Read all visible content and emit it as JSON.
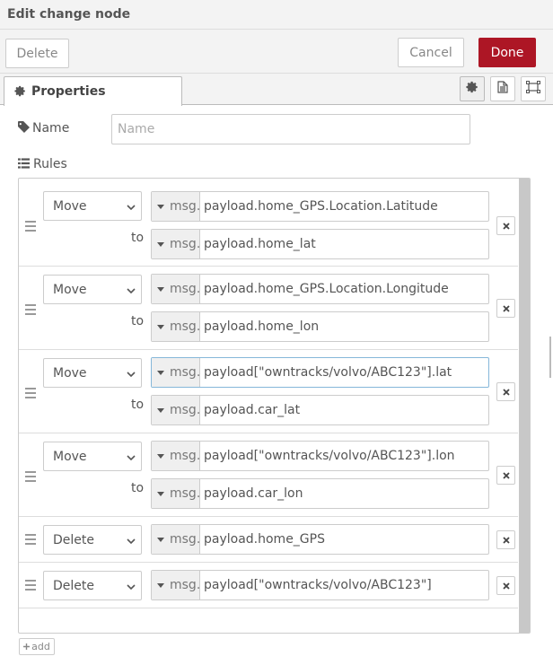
{
  "header": {
    "title": "Edit change node"
  },
  "toolbar": {
    "delete_label": "Delete",
    "cancel_label": "Cancel",
    "done_label": "Done"
  },
  "tabs": {
    "properties_label": "Properties"
  },
  "form": {
    "name_label": "Name",
    "name_value": "",
    "name_placeholder": "Name",
    "rules_label": "Rules"
  },
  "rules": [
    {
      "action": "Move",
      "from_type": "msg.",
      "from_value": "payload.home_GPS.Location.Latitude",
      "to_label": "to",
      "to_type": "msg.",
      "to_value": "payload.home_lat"
    },
    {
      "action": "Move",
      "from_type": "msg.",
      "from_value": "payload.home_GPS.Location.Longitude",
      "to_label": "to",
      "to_type": "msg.",
      "to_value": "payload.home_lon"
    },
    {
      "action": "Move",
      "from_type": "msg.",
      "from_value": "payload[\"owntracks/volvo/ABC123\"].lat",
      "to_label": "to",
      "to_type": "msg.",
      "to_value": "payload.car_lat"
    },
    {
      "action": "Move",
      "from_type": "msg.",
      "from_value": "payload[\"owntracks/volvo/ABC123\"].lon",
      "to_label": "to",
      "to_type": "msg.",
      "to_value": "payload.car_lon"
    },
    {
      "action": "Delete",
      "from_type": "msg.",
      "from_value": "payload.home_GPS"
    },
    {
      "action": "Delete",
      "from_type": "msg.",
      "from_value": "payload[\"owntracks/volvo/ABC123\"]"
    }
  ],
  "add_label": "add",
  "colors": {
    "done_button": "#ad1625",
    "header_bg": "#f3f3f3",
    "focus_border": "#85b7d9"
  }
}
